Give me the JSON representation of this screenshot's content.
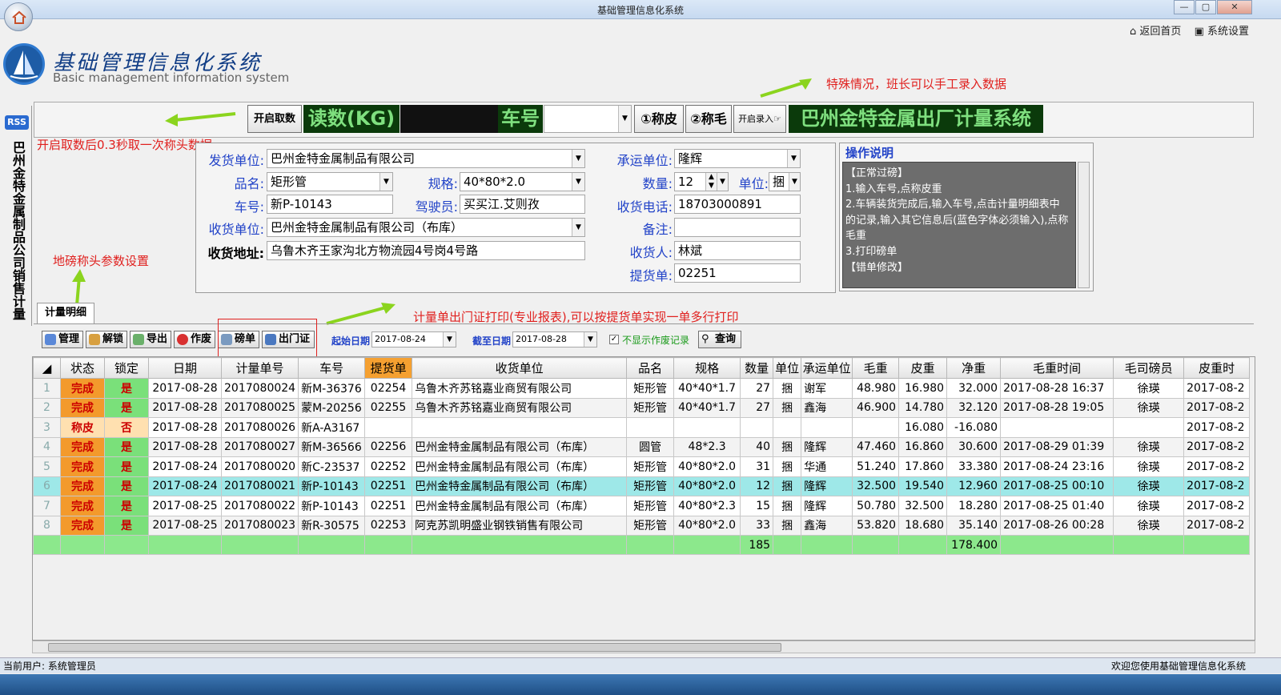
{
  "window": {
    "title": "基础管理信息化系统",
    "min": "—",
    "max": "▢",
    "close": "✕"
  },
  "toplinks": {
    "home": "返回首页",
    "settings": "系统设置"
  },
  "logo": {
    "title": "基础管理信息化系统",
    "subtitle": "Basic management information system"
  },
  "sidebar": {
    "rss": "RSS",
    "tab_label": "巴州金特金属制品公司销售计量"
  },
  "weigh_bar": {
    "start_read": "开启取数",
    "reading_label": "读数(KG)",
    "plate_label": "车号",
    "plate_value": "",
    "tare_button": "①称皮",
    "gross_button": "②称毛",
    "manual_button": "开启录入",
    "banner": "巴州金特金属出厂计量系统"
  },
  "notes": {
    "manual_entry": "特殊情况，班长可以手工录入数据",
    "auto_read": "开启取数后0.3秒取一次称头数据",
    "scale_settings": "地磅称头参数设置",
    "print_note": "计量单出门证打印(专业报表),可以按提货单实现一单多行打印"
  },
  "form": {
    "shipper_label": "发货单位:",
    "shipper": "巴州金特金属制品有限公司",
    "product_label": "品名:",
    "product": "矩形管",
    "spec_label": "规格:",
    "spec": "40*80*2.0",
    "plate_label": "车号:",
    "plate": "新P-10143",
    "driver_label": "驾驶员:",
    "driver": "买买江.艾则孜",
    "receiver_label": "收货单位:",
    "receiver": "巴州金特金属制品有限公司（布库）",
    "address_label": "收货地址:",
    "address": "乌鲁木齐王家沟北方物流园4号岗4号路",
    "carrier_label": "承运单位:",
    "carrier": "隆辉",
    "qty_label": "数量:",
    "qty": "12",
    "unit_label": "单位:",
    "unit": "捆",
    "phone_label": "收货电话:",
    "phone": "18703000891",
    "remark_label": "备注:",
    "remark": "",
    "consignee_label": "收货人:",
    "consignee": "林斌",
    "order_label": "提货单:",
    "order": "02251"
  },
  "ops": {
    "title": "操作说明",
    "lines": [
      "【正常过磅】",
      "1.输入车号,点称皮重",
      "2.车辆装货完成后,输入车号,点击计量明细表中",
      "的记录,输入其它信息后(蓝色字体必须输入),点称",
      "毛重",
      "3.打印磅单",
      "【错单修改】"
    ]
  },
  "detail_tab": "计量明细",
  "toolbar": {
    "manage": "管理",
    "unlock": "解锁",
    "export": "导出",
    "void": "作废",
    "ticket": "磅单",
    "gate_pass": "出门证",
    "start_label": "起始日期",
    "start_date": "2017-08-24",
    "end_label": "截至日期",
    "end_date": "2017-08-28",
    "hide_void": "不显示作废记录",
    "query": "查询"
  },
  "table": {
    "headers": [
      "状态",
      "锁定",
      "日期",
      "计量单号",
      "车号",
      "提货单",
      "收货单位",
      "品名",
      "规格",
      "数量",
      "单位",
      "承运单位",
      "毛重",
      "皮重",
      "净重",
      "毛重时间",
      "毛司磅员",
      "皮重时"
    ],
    "rows": [
      [
        "1",
        "完成",
        "是",
        "2017-08-28",
        "2017080024",
        "新M-36376",
        "02254",
        "乌鲁木齐苏铭嘉业商贸有限公司",
        "矩形管",
        "40*40*1.7",
        "27",
        "捆",
        "谢军",
        "48.980",
        "16.980",
        "32.000",
        "2017-08-28 16:37",
        "徐瑛",
        "2017-08-2"
      ],
      [
        "2",
        "完成",
        "是",
        "2017-08-28",
        "2017080025",
        "蒙M-20256",
        "02255",
        "乌鲁木齐苏铭嘉业商贸有限公司",
        "矩形管",
        "40*40*1.7",
        "27",
        "捆",
        "鑫海",
        "46.900",
        "14.780",
        "32.120",
        "2017-08-28 19:05",
        "徐瑛",
        "2017-08-2"
      ],
      [
        "3",
        "称皮",
        "否",
        "2017-08-28",
        "2017080026",
        "新A-A3167",
        "",
        "",
        "",
        "",
        "",
        "",
        "",
        "",
        "16.080",
        "-16.080",
        "",
        "",
        "2017-08-2"
      ],
      [
        "4",
        "完成",
        "是",
        "2017-08-28",
        "2017080027",
        "新M-36566",
        "02256",
        "巴州金特金属制品有限公司（布库）",
        "圆管",
        "48*2.3",
        "40",
        "捆",
        "隆辉",
        "47.460",
        "16.860",
        "30.600",
        "2017-08-29 01:39",
        "徐瑛",
        "2017-08-2"
      ],
      [
        "5",
        "完成",
        "是",
        "2017-08-24",
        "2017080020",
        "新C-23537",
        "02252",
        "巴州金特金属制品有限公司（布库）",
        "矩形管",
        "40*80*2.0",
        "31",
        "捆",
        "华通",
        "51.240",
        "17.860",
        "33.380",
        "2017-08-24 23:16",
        "徐瑛",
        "2017-08-2"
      ],
      [
        "6",
        "完成",
        "是",
        "2017-08-24",
        "2017080021",
        "新P-10143",
        "02251",
        "巴州金特金属制品有限公司（布库）",
        "矩形管",
        "40*80*2.0",
        "12",
        "捆",
        "隆辉",
        "32.500",
        "19.540",
        "12.960",
        "2017-08-25 00:10",
        "徐瑛",
        "2017-08-2"
      ],
      [
        "7",
        "完成",
        "是",
        "2017-08-25",
        "2017080022",
        "新P-10143",
        "02251",
        "巴州金特金属制品有限公司（布库）",
        "矩形管",
        "40*80*2.3",
        "15",
        "捆",
        "隆辉",
        "50.780",
        "32.500",
        "18.280",
        "2017-08-25 01:40",
        "徐瑛",
        "2017-08-2"
      ],
      [
        "8",
        "完成",
        "是",
        "2017-08-25",
        "2017080023",
        "新R-30575",
        "02253",
        "阿克苏凯明盛业钢铁销售有限公司",
        "矩形管",
        "40*80*2.0",
        "33",
        "捆",
        "鑫海",
        "53.820",
        "18.680",
        "35.140",
        "2017-08-26 00:28",
        "徐瑛",
        "2017-08-2"
      ]
    ],
    "total_qty": "185",
    "total_net": "178.400"
  },
  "status": {
    "user": "当前用户: 系统管理员",
    "welcome": "欢迎您使用基础管理信息化系统"
  }
}
